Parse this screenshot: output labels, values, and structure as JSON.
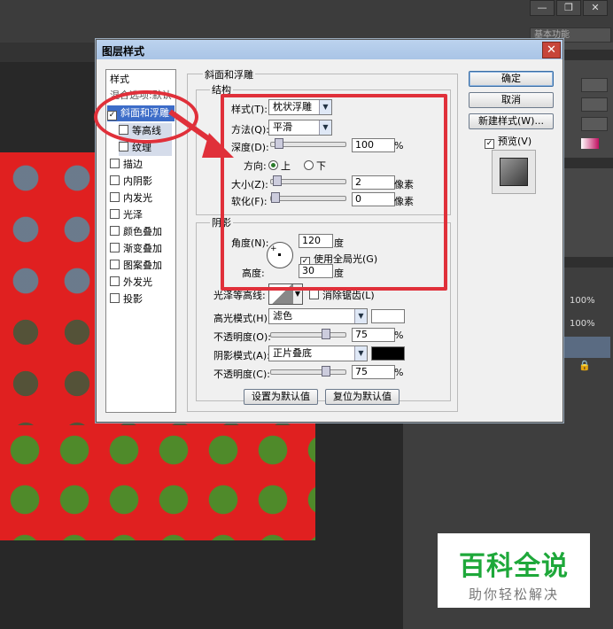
{
  "window_controls": {
    "minimize": "—",
    "restore": "❐",
    "close": "✕"
  },
  "workspace": {
    "label": "基本功能"
  },
  "right_panels": {
    "zoom_1": "100%",
    "zoom_2": "100%"
  },
  "watermark": {
    "title": "百科全说",
    "subtitle": "助你轻松解决"
  },
  "dialog": {
    "title": "图层样式",
    "close": "✕",
    "style_list": {
      "header": "样式",
      "blend_options": "混合选项:默认",
      "items": [
        {
          "label": "斜面和浮雕",
          "checked": true
        },
        {
          "label": "等高线",
          "checked": false
        },
        {
          "label": "纹理",
          "checked": false
        },
        {
          "label": "描边",
          "checked": false
        },
        {
          "label": "内阴影",
          "checked": false
        },
        {
          "label": "内发光",
          "checked": false
        },
        {
          "label": "光泽",
          "checked": false
        },
        {
          "label": "颜色叠加",
          "checked": false
        },
        {
          "label": "渐变叠加",
          "checked": false
        },
        {
          "label": "图案叠加",
          "checked": false
        },
        {
          "label": "外发光",
          "checked": false
        },
        {
          "label": "投影",
          "checked": false
        }
      ]
    },
    "bevel": {
      "group_title": "斜面和浮雕",
      "structure_title": "结构",
      "style_label": "样式(T):",
      "style_value": "枕状浮雕",
      "technique_label": "方法(Q):",
      "technique_value": "平滑",
      "depth_label": "深度(D):",
      "depth_value": "100",
      "depth_level": 0.05,
      "depth_unit": "%",
      "direction_label": "方向:",
      "direction_up": "上",
      "direction_down": "下",
      "size_label": "大小(Z):",
      "size_value": "2",
      "size_level": 0.02,
      "size_unit": "像素",
      "soften_label": "软化(F):",
      "soften_value": "0",
      "soften_level": 0.0,
      "soften_unit": "像素"
    },
    "shading": {
      "title": "阴影",
      "angle_label": "角度(N):",
      "angle_value": "120",
      "angle_unit": "度",
      "global_light_label": "使用全局光(G)",
      "global_light_checked": true,
      "altitude_label": "高度:",
      "altitude_value": "30",
      "altitude_unit": "度",
      "gloss_contour_label": "光泽等高线:",
      "antialias_label": "消除锯齿(L)",
      "highlight_mode_label": "高光模式(H):",
      "highlight_mode_value": "滤色",
      "highlight_color": "#ffffff",
      "highlight_opacity_label": "不透明度(O):",
      "highlight_opacity_value": "75",
      "highlight_opacity_level": 0.75,
      "shadow_mode_label": "阴影模式(A):",
      "shadow_mode_value": "正片叠底",
      "shadow_color": "#000000",
      "shadow_opacity_label": "不透明度(C):",
      "shadow_opacity_value": "75",
      "shadow_opacity_level": 0.75,
      "percent": "%"
    },
    "buttons": {
      "ok": "确定",
      "cancel": "取消",
      "new_style": "新建样式(W)...",
      "preview_label": "预览(V)",
      "preview_checked": true,
      "make_default": "设置为默认值",
      "reset_default": "复位为默认值"
    }
  },
  "colors": {
    "annotation": "#e0303a",
    "selection": "#3c6cc8"
  }
}
